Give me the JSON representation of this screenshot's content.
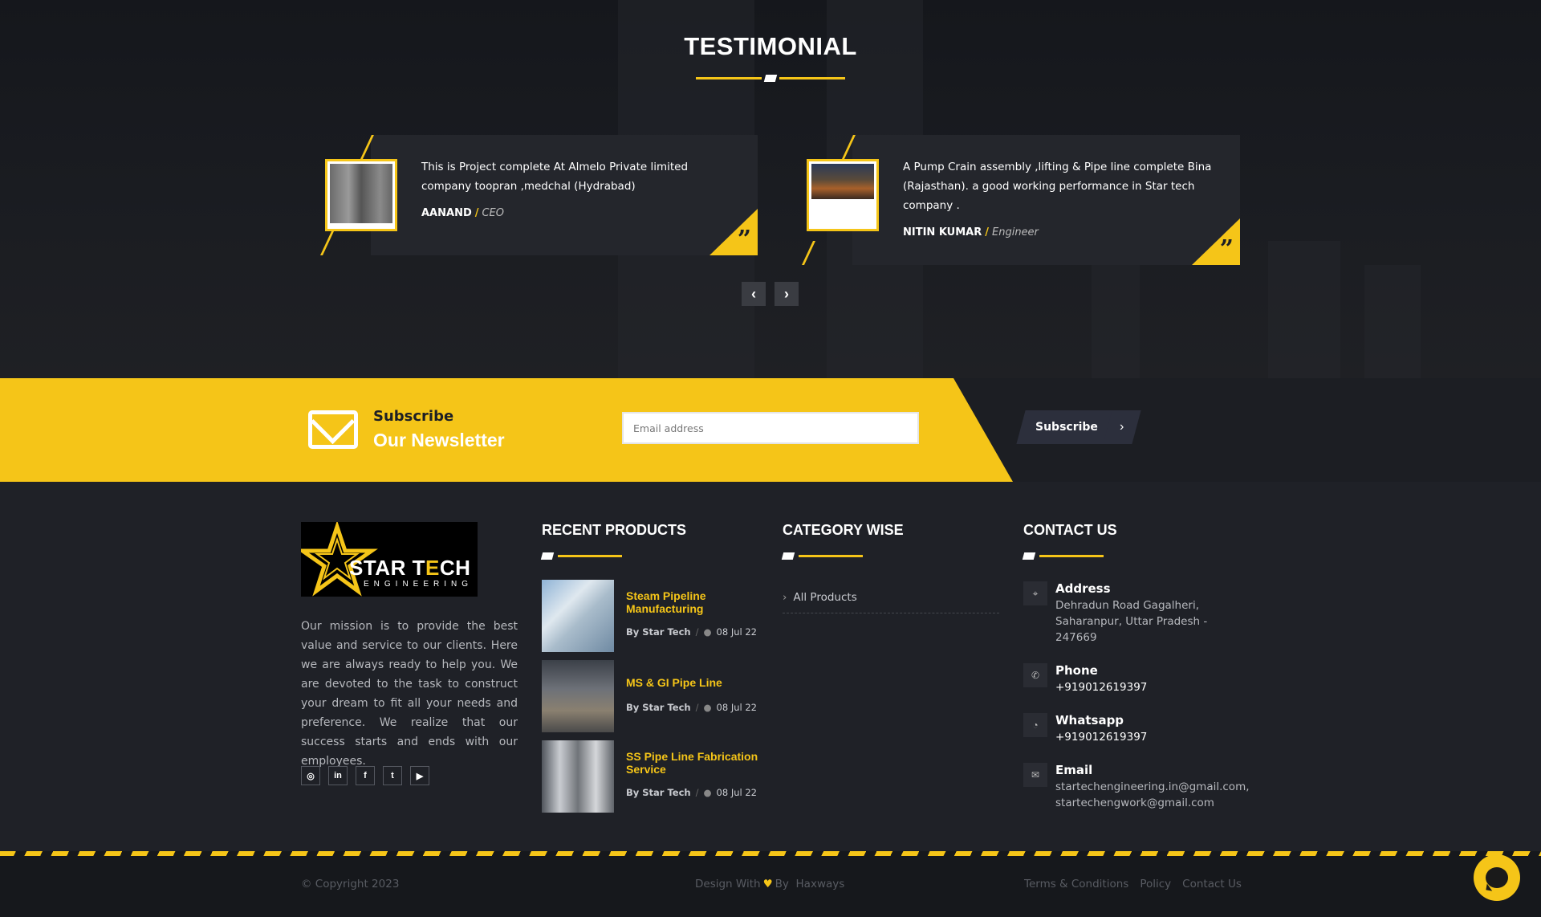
{
  "testimonial": {
    "title": "TESTIMONIAL",
    "items": [
      {
        "text": "This is Project complete At Almelo Private limited company toopran ,medchal (Hydrabad)",
        "name": "AANAND",
        "role": "CEO"
      },
      {
        "text": "A Pump Crain assembly ,lifting & Pipe line complete Bina (Rajasthan). a good working performance in Star tech company .",
        "name": "NITIN KUMAR",
        "role": "Engineer"
      }
    ],
    "prev_icon": "chevron-left-icon",
    "next_icon": "chevron-right-icon"
  },
  "newsletter": {
    "line1": "Subscribe",
    "line2": "Our Newsletter",
    "email_placeholder": "Email address",
    "button_label": "Subscribe"
  },
  "footer": {
    "logo_text": {
      "star": "STAR",
      "tech": "T",
      "tech_highlight": "E",
      "tech_rest": "CH",
      "sub": "ENGINEERING"
    },
    "mission": "Our mission is to provide the best value and service to our clients. Here we are always ready to help you. We are devoted to the task to construct your dream to fit all your needs and preference. We realize that our success starts and ends with our employees.",
    "socials": [
      "instagram-icon",
      "linkedin-icon",
      "facebook-icon",
      "twitter-icon",
      "youtube-icon"
    ],
    "recent_products": {
      "title": "RECENT PRODUCTS",
      "items": [
        {
          "title": "Steam Pipeline Manufacturing",
          "by": "By Star Tech",
          "date": "08 Jul 22"
        },
        {
          "title": "MS & GI Pipe Line",
          "by": "By Star Tech",
          "date": "08 Jul 22"
        },
        {
          "title": "SS Pipe Line Fabrication Service",
          "by": "By Star Tech",
          "date": "08 Jul 22"
        }
      ]
    },
    "category": {
      "title": "CATEGORY WISE",
      "items": [
        "All Products"
      ]
    },
    "contact": {
      "title": "CONTACT US",
      "address_label": "Address",
      "address_value": "Dehradun Road Gagalheri, Saharanpur, Uttar Pradesh - 247669",
      "phone_label": "Phone",
      "phone_value": "+919012619397",
      "whatsapp_label": "Whatsapp",
      "whatsapp_value": "+919012619397",
      "email_label": "Email",
      "email_value_1": "startechengineering.in@gmail.com,",
      "email_value_2": "startechengwork@gmail.com"
    }
  },
  "bottom": {
    "copyright": "© Copyright 2023",
    "design_prefix": "Design With",
    "design_by": "By",
    "design_name": "Haxways",
    "links": [
      "Terms & Conditions",
      "Policy",
      "Contact Us"
    ]
  },
  "colors": {
    "accent": "#f5c518",
    "background": "#1f2127"
  }
}
